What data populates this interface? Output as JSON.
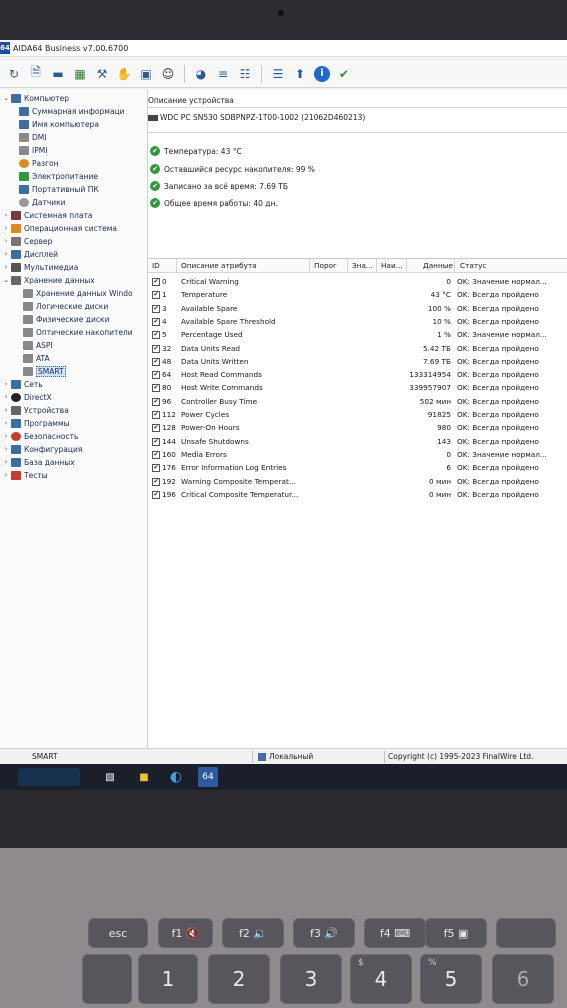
{
  "window": {
    "app_logo": "64",
    "title": "AIDA64 Business v7.00.6700"
  },
  "toolbar": {
    "icons": [
      "refresh-icon",
      "report-icon",
      "network-icon",
      "memory-icon",
      "driver-icon",
      "tools-icon",
      "hardware-icon",
      "user-icon",
      "aida-icon",
      "database-icon",
      "report-list-icon",
      "list-icon",
      "upload-icon",
      "info-icon",
      "tools-check-icon"
    ]
  },
  "tree": {
    "items": [
      {
        "label": "Компьютер"
      },
      {
        "label": "Суммарная информаци"
      },
      {
        "label": "Имя компьютера"
      },
      {
        "label": "DMI"
      },
      {
        "label": "IPMI"
      },
      {
        "label": "Разгон"
      },
      {
        "label": "Электропитание"
      },
      {
        "label": "Портативный ПК"
      },
      {
        "label": "Датчики"
      },
      {
        "label": "Системная плата"
      },
      {
        "label": "Операционная система"
      },
      {
        "label": "Сервер"
      },
      {
        "label": "Дисплей"
      },
      {
        "label": "Мультимедиа"
      },
      {
        "label": "Хранение данных"
      },
      {
        "label": "Хранение данных Windo"
      },
      {
        "label": "Логические диски"
      },
      {
        "label": "Физические диски"
      },
      {
        "label": "Оптические накопители"
      },
      {
        "label": "ASPI"
      },
      {
        "label": "ATA"
      },
      {
        "label": "SMART"
      },
      {
        "label": "Сеть"
      },
      {
        "label": "DirectX"
      },
      {
        "label": "Устройства"
      },
      {
        "label": "Программы"
      },
      {
        "label": "Безопасность"
      },
      {
        "label": "Конфигурация"
      },
      {
        "label": "База данных"
      },
      {
        "label": "Тесты"
      }
    ]
  },
  "device": {
    "header": "Описание устройства",
    "name": "WDC PC SN530 SDBPNPZ-1T00-1002 (21062D460213)"
  },
  "summary": [
    {
      "text": "Температура: 43 °C"
    },
    {
      "text": "Оставшийся ресурс накопителя: 99 %"
    },
    {
      "text": "Записано за всё время: 7.69 ТБ"
    },
    {
      "text": "Общее время работы: 40 дн."
    }
  ],
  "table": {
    "headers": {
      "id": "ID",
      "desc": "Описание атрибута",
      "threshold": "Порог",
      "value": "Зна...",
      "worst": "Наи...",
      "data": "Данные",
      "status": "Статус"
    },
    "rows": [
      {
        "id": "0",
        "name": "Critical Warning",
        "data": "0",
        "status": "OK: Значение нормал..."
      },
      {
        "id": "1",
        "name": "Temperature",
        "data": "43 °C",
        "status": "OK: Всегда пройдено"
      },
      {
        "id": "3",
        "name": "Available Spare",
        "data": "100 %",
        "status": "OK: Всегда пройдено"
      },
      {
        "id": "4",
        "name": "Available Spare Threshold",
        "data": "10 %",
        "status": "OK: Всегда пройдено"
      },
      {
        "id": "5",
        "name": "Percentage Used",
        "data": "1 %",
        "status": "OK: Значение нормал..."
      },
      {
        "id": "32",
        "name": "Data Units Read",
        "data": "5.42 ТБ",
        "status": "OK: Всегда пройдено"
      },
      {
        "id": "48",
        "name": "Data Units Written",
        "data": "7.69 ТБ",
        "status": "OK: Всегда пройдено"
      },
      {
        "id": "64",
        "name": "Host Read Commands",
        "data": "133314954",
        "status": "OK: Всегда пройдено"
      },
      {
        "id": "80",
        "name": "Host Write Commands",
        "data": "339957907",
        "status": "OK: Всегда пройдено"
      },
      {
        "id": "96",
        "name": "Controller Busy Time",
        "data": "502 мин",
        "status": "OK: Всегда пройдено"
      },
      {
        "id": "112",
        "name": "Power Cycles",
        "data": "91825",
        "status": "OK: Всегда пройдено"
      },
      {
        "id": "128",
        "name": "Power-On Hours",
        "data": "980",
        "status": "OK: Всегда пройдено"
      },
      {
        "id": "144",
        "name": "Unsafe Shutdowns",
        "data": "143",
        "status": "OK: Всегда пройдено"
      },
      {
        "id": "160",
        "name": "Media Errors",
        "data": "0",
        "status": "OK: Значение нормал..."
      },
      {
        "id": "176",
        "name": "Error Information Log Entries",
        "data": "6",
        "status": "OK: Всегда пройдено"
      },
      {
        "id": "192",
        "name": "Warning Composite Temperat...",
        "data": "0 мин",
        "status": "OK: Всегда пройдено"
      },
      {
        "id": "196",
        "name": "Critical Composite Temperatur...",
        "data": "0 мин",
        "status": "OK: Всегда пройдено"
      }
    ]
  },
  "statusbar": {
    "left": "SMART",
    "middle": "Локальный",
    "right": "Copyright (c) 1995-2023 FinalWire Ltd."
  },
  "taskbar": {
    "aida_label": "64"
  },
  "keyboard": {
    "keys": {
      "esc": "esc",
      "f1": "f1",
      "f2": "f2",
      "f3": "f3",
      "f4": "f4",
      "f5": "f5",
      "k1": "1",
      "k2": "2",
      "k3": "3",
      "k4": "4",
      "k5": "5",
      "k6": "6",
      "k4_shift": "$",
      "k5_shift": "%"
    }
  },
  "colors": {
    "ok_green": "#2e9a3a",
    "title_blue": "#1a4fa0",
    "selection": "#cfe3f7"
  }
}
